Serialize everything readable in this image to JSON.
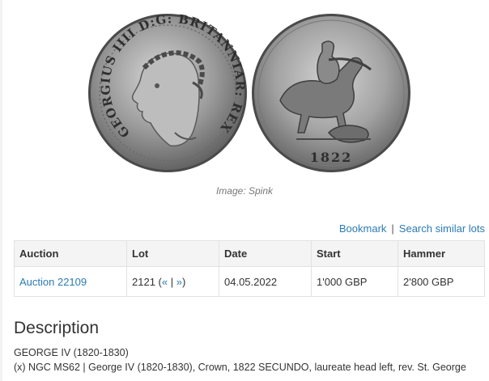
{
  "image": {
    "caption": "Image: Spink",
    "obverse_legend": "GEORGIUS IIII D:G: BRITANNIAR: REX F:D:",
    "reverse_year": "1822"
  },
  "actions": {
    "bookmark": "Bookmark",
    "separator": "|",
    "search_similar": "Search similar lots"
  },
  "table": {
    "headers": [
      "Auction",
      "Lot",
      "Date",
      "Start",
      "Hammer"
    ],
    "row": {
      "auction": "Auction 22109",
      "lot_number": "2121",
      "lot_open": "(",
      "prev": "«",
      "nav_sep": " | ",
      "next": "»",
      "lot_close": ")",
      "date": "04.05.2022",
      "start": "1'000 GBP",
      "hammer": "2'800 GBP"
    }
  },
  "description": {
    "title": "Description",
    "line1": "GEORGE IV (1820-1830)",
    "line2": "(x) NGC MS62 | George IV (1820-1830), Crown, 1822 SECUNDO, laureate head left, rev. St. George"
  }
}
